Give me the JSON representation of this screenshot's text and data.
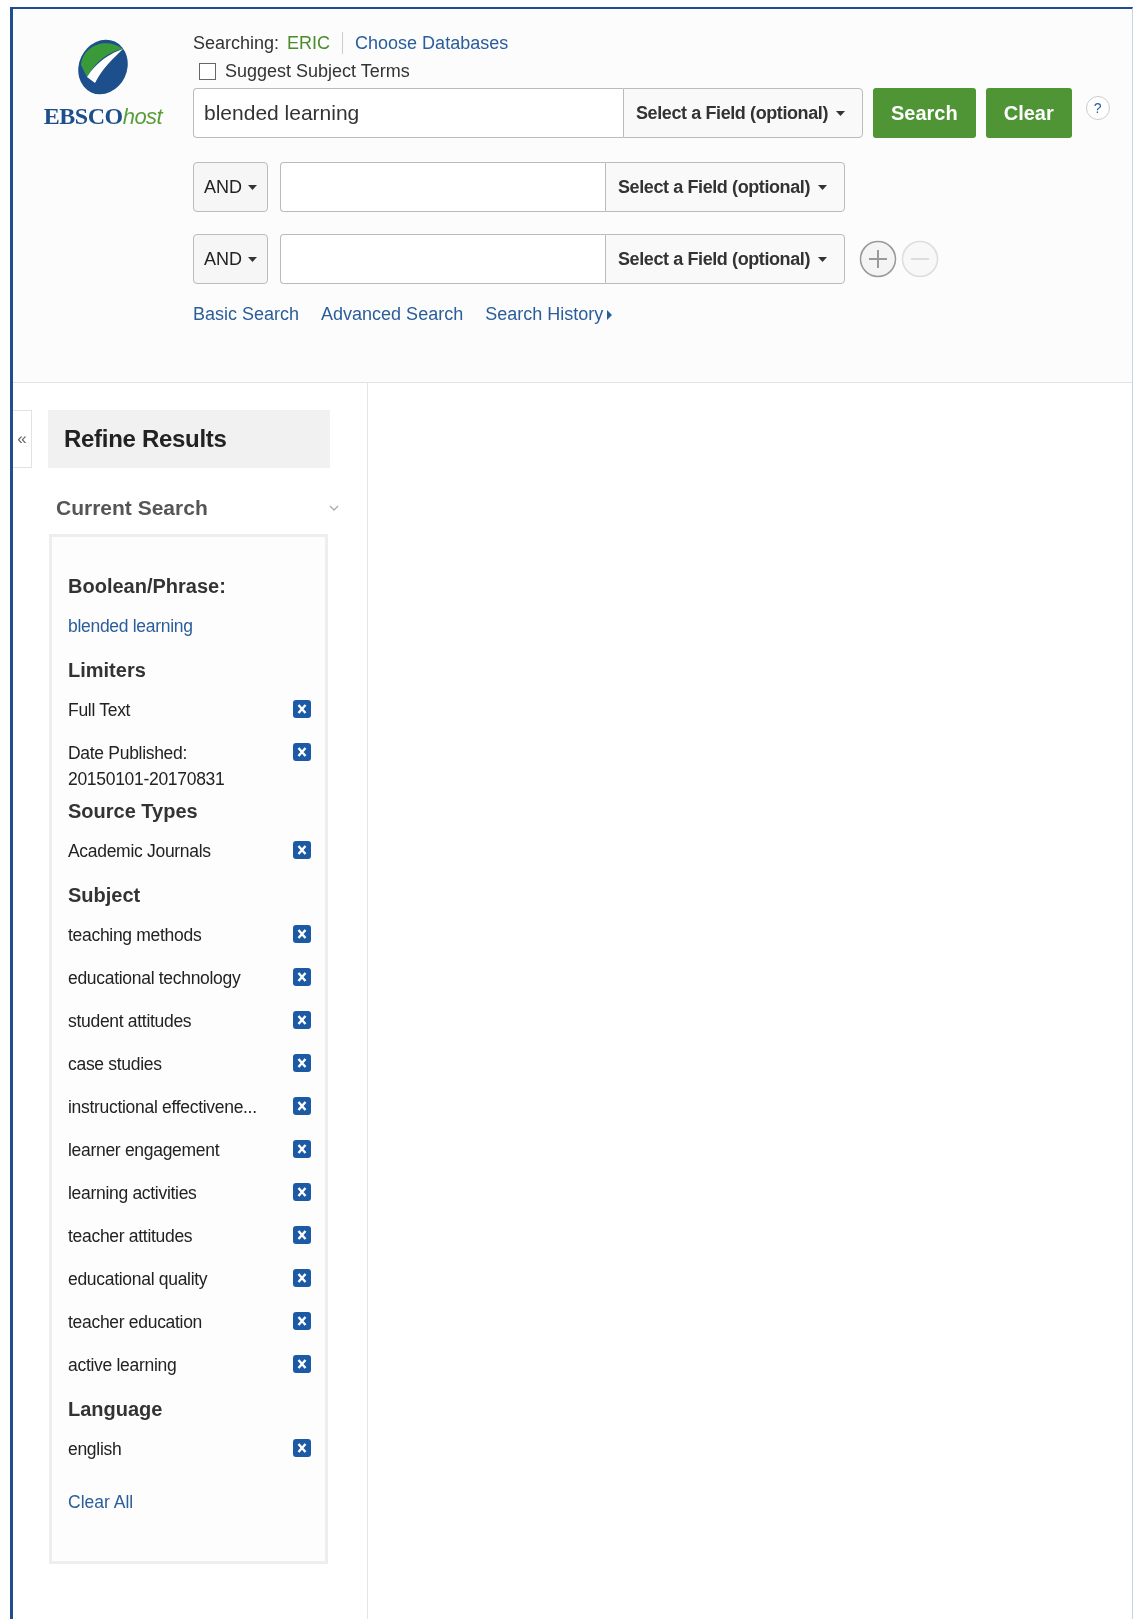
{
  "logo": {
    "brand": "EBSCO",
    "suffix": "host"
  },
  "searching": {
    "label": "Searching:",
    "database": "ERIC",
    "choose_link": "Choose Databases"
  },
  "suggest": {
    "label": "Suggest Subject Terms",
    "checked": false
  },
  "search_rows": [
    {
      "kind": "main",
      "value": "blended learning",
      "field": "Select a Field (optional)"
    },
    {
      "kind": "extra",
      "operator": "AND",
      "field": "Select a Field (optional)"
    },
    {
      "kind": "extra",
      "operator": "AND",
      "field": "Select a Field (optional)"
    }
  ],
  "buttons": {
    "search": "Search",
    "clear": "Clear",
    "help": "?"
  },
  "row_controls": {
    "add_disabled": false,
    "remove_disabled": true
  },
  "links": [
    {
      "label": "Basic Search",
      "kind": "plain"
    },
    {
      "label": "Advanced Search",
      "kind": "plain"
    },
    {
      "label": "Search History",
      "kind": "menu"
    }
  ],
  "sidebar": {
    "collapse": "«",
    "title": "Refine Results",
    "section": {
      "title": "Current Search",
      "expanded": true
    },
    "groups": [
      {
        "heading": "Boolean/Phrase:",
        "items": [
          {
            "label": "blended learning",
            "kind": "link"
          }
        ]
      },
      {
        "heading": "Limiters",
        "items": [
          {
            "label": "Full Text",
            "kind": "removable"
          },
          {
            "label": "Date Published:\n20150101-20170831",
            "kind": "removable"
          }
        ]
      },
      {
        "heading": "Source Types",
        "items": [
          {
            "label": "Academic Journals",
            "kind": "removable"
          }
        ]
      },
      {
        "heading": "Subject",
        "items": [
          {
            "label": "teaching methods",
            "kind": "removable"
          },
          {
            "label": "educational technology",
            "kind": "removable"
          },
          {
            "label": "student attitudes",
            "kind": "removable"
          },
          {
            "label": "case studies",
            "kind": "removable"
          },
          {
            "label": "instructional effectivene...",
            "kind": "removable"
          },
          {
            "label": "learner engagement",
            "kind": "removable"
          },
          {
            "label": "learning activities",
            "kind": "removable"
          },
          {
            "label": "teacher attitudes",
            "kind": "removable"
          },
          {
            "label": "educational quality",
            "kind": "removable"
          },
          {
            "label": "teacher education",
            "kind": "removable"
          },
          {
            "label": "active learning",
            "kind": "removable"
          }
        ]
      },
      {
        "heading": "Language",
        "items": [
          {
            "label": "english",
            "kind": "removable"
          }
        ]
      }
    ],
    "clear_all": "Clear All"
  }
}
